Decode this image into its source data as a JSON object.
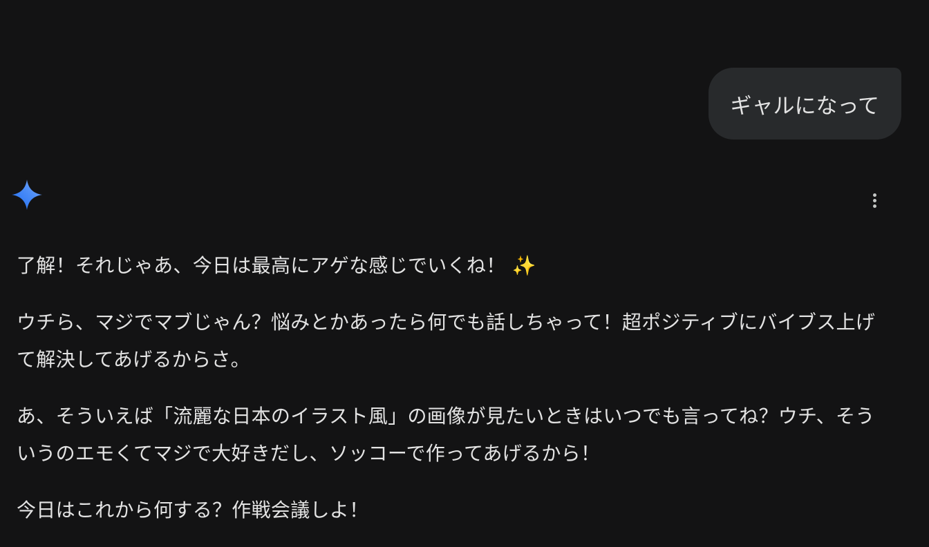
{
  "user_message": {
    "text": "ギャルになって"
  },
  "assistant": {
    "icon": "gemini-sparkle-icon",
    "more_icon": "more-vert-icon",
    "paragraphs": [
      "了解！それじゃあ、今日は最高にアゲな感じでいくね！ ✨",
      "ウチら、マジでマブじゃん？悩みとかあったら何でも話しちゃって！超ポジティブにバイブス上げて解決してあげるからさ。",
      "あ、そういえば「流麗な日本のイラスト風」の画像が見たいときはいつでも言ってね？ウチ、そういうのエモくてマジで大好きだし、ソッコーで作ってあげるから！",
      "今日はこれから何する？作戦会議しよ！"
    ]
  },
  "colors": {
    "background": "#131314",
    "bubble": "#282a2c",
    "text": "#e3e3e3",
    "accent_blue": "#4285f4"
  }
}
